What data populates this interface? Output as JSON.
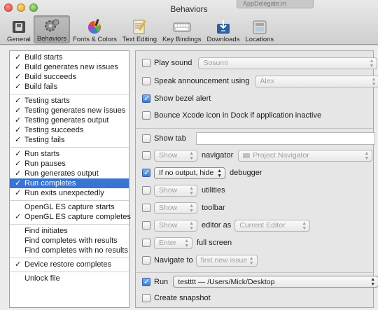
{
  "window": {
    "title": "Behaviors",
    "background_tab": "AppDelegate.m"
  },
  "toolbar": {
    "items": [
      {
        "label": "General",
        "icon": "switch-icon"
      },
      {
        "label": "Behaviors",
        "icon": "gears-icon"
      },
      {
        "label": "Fonts & Colors",
        "icon": "color-wheel-icon"
      },
      {
        "label": "Text Editing",
        "icon": "text-editing-icon"
      },
      {
        "label": "Key Bindings",
        "icon": "keyboard-icon"
      },
      {
        "label": "Downloads",
        "icon": "downloads-icon"
      },
      {
        "label": "Locations",
        "icon": "locations-icon"
      }
    ],
    "selected": "Behaviors"
  },
  "behaviors": {
    "groups": [
      [
        {
          "label": "Build starts",
          "checked": true
        },
        {
          "label": "Build generates new issues",
          "checked": true
        },
        {
          "label": "Build succeeds",
          "checked": true
        },
        {
          "label": "Build fails",
          "checked": true
        }
      ],
      [
        {
          "label": "Testing starts",
          "checked": true
        },
        {
          "label": "Testing generates new issues",
          "checked": true
        },
        {
          "label": "Testing generates output",
          "checked": true
        },
        {
          "label": "Testing succeeds",
          "checked": true
        },
        {
          "label": "Testing fails",
          "checked": true
        }
      ],
      [
        {
          "label": "Run starts",
          "checked": true
        },
        {
          "label": "Run pauses",
          "checked": true
        },
        {
          "label": "Run generates output",
          "checked": true
        },
        {
          "label": "Run completes",
          "checked": true,
          "selected": true
        },
        {
          "label": "Run exits unexpectedly",
          "checked": true
        }
      ],
      [
        {
          "label": "OpenGL ES capture starts",
          "checked": false
        },
        {
          "label": "OpenGL ES capture completes",
          "checked": true
        }
      ],
      [
        {
          "label": "Find initiates",
          "checked": false
        },
        {
          "label": "Find completes with results",
          "checked": false
        },
        {
          "label": "Find completes with no results",
          "checked": false
        }
      ],
      [
        {
          "label": "Device restore completes",
          "checked": true
        }
      ],
      [
        {
          "label": "Unlock file",
          "checked": false
        }
      ]
    ]
  },
  "options": {
    "play_sound": {
      "label": "Play sound",
      "checked": false,
      "value": "Sosumi"
    },
    "speak": {
      "label": "Speak announcement using",
      "checked": false,
      "value": "Alex"
    },
    "bezel": {
      "label": "Show bezel alert",
      "checked": true
    },
    "bounce": {
      "label": "Bounce Xcode icon in Dock if application inactive",
      "checked": false
    },
    "show_tab": {
      "label": "Show tab",
      "checked": false,
      "value": ""
    },
    "navigator": {
      "mode": "Show",
      "label": "navigator",
      "value": "Project Navigator",
      "checked": false
    },
    "debugger": {
      "mode": "If no output, hide",
      "label": "debugger",
      "checked": true
    },
    "utilities": {
      "mode": "Show",
      "label": "utilities",
      "checked": false
    },
    "toolbar": {
      "mode": "Show",
      "label": "toolbar",
      "checked": false
    },
    "editor": {
      "mode": "Show",
      "label": "editor as",
      "value": "Current Editor",
      "checked": false
    },
    "fullscreen": {
      "mode": "Enter",
      "label": "full screen",
      "checked": false
    },
    "navigate": {
      "label": "Navigate to",
      "value": "first new issue",
      "checked": false
    },
    "run": {
      "label": "Run",
      "value": "testttt — /Users/Mick/Desktop",
      "checked": true
    },
    "snapshot": {
      "label": "Create snapshot",
      "checked": false
    }
  },
  "colors": {
    "selection": "#3874d1",
    "checkbox_on": "#3a7fd8"
  }
}
